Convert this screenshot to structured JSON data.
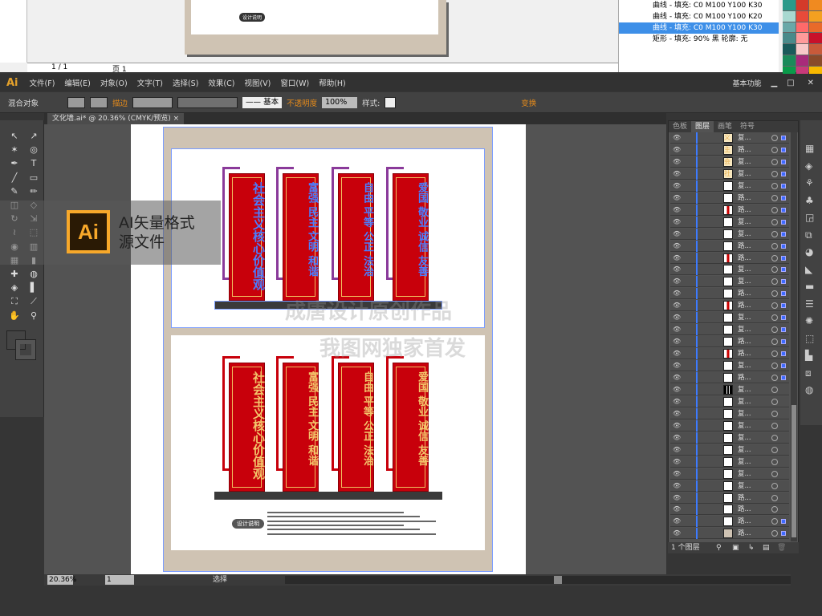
{
  "corel": {
    "page_nav": "1 / 1",
    "page_tab": "页 1",
    "design_note_label": "设计说明",
    "object_manager": [
      {
        "label": "曲线 - 填充: C0 M100 Y100 K30",
        "selected": false
      },
      {
        "label": "曲线 - 填充: C0 M100 Y100 K20",
        "selected": false
      },
      {
        "label": "曲线 - 填充: C0 M100 Y100 K30",
        "selected": true
      },
      {
        "label": "矩形 - 填充: 90% 黑 轮廓: 无",
        "selected": false
      }
    ],
    "palette": [
      "#2a9a8a",
      "#d43a2a",
      "#f08a20",
      "#a8d8d0",
      "#e84a3a",
      "#f4a020",
      "#6aa8a8",
      "#ff6a6a",
      "#e86a2a",
      "#4a8a8a",
      "#ff9a9a",
      "#c8102a",
      "#1a5a5a",
      "#f8c8c8",
      "#c85a3a",
      "#1a8a5a",
      "#a82a7a",
      "#8a4a2a",
      "#0a9a4a",
      "#c83a7a",
      "#f8b800"
    ]
  },
  "app": {
    "logo": "Ai",
    "workspace": "基本功能"
  },
  "menu": [
    "文件(F)",
    "编辑(E)",
    "对象(O)",
    "文字(T)",
    "选择(S)",
    "效果(C)",
    "视图(V)",
    "窗口(W)",
    "帮助(H)"
  ],
  "control": {
    "object_type": "混合对象",
    "stroke_label": "描边",
    "stroke_style": "基本",
    "opacity_label": "不透明度",
    "opacity_value": "100%",
    "style_label": "样式:",
    "transform_label": "变换"
  },
  "document": {
    "tab_title": "文化墙.ai* @ 20.36% (CMYK/预览)"
  },
  "overlay": {
    "line1": "AI矢量格式",
    "line2": "源文件"
  },
  "watermarks": [
    "成唐设计原创作品",
    "我图网独家首发"
  ],
  "artwork": {
    "panels": [
      "社会主义核心价值观",
      "富强 民主 文明 和谐",
      "自由 平等 公正 法治",
      "爱国 敬业 诚信 友善"
    ],
    "design_note": "设计说明"
  },
  "layers_panel": {
    "tabs": [
      "色板",
      "图层",
      "画笔",
      "符号"
    ],
    "active_tab": "图层",
    "footer": "1 个图层",
    "rows": [
      {
        "name": "复...",
        "thumb": "义",
        "target": true
      },
      {
        "name": "路...",
        "thumb": "主",
        "target": true
      },
      {
        "name": "复...",
        "thumb": "会",
        "target": true
      },
      {
        "name": "复...",
        "thumb": "社",
        "target": true
      },
      {
        "name": "复...",
        "thumb": "",
        "target": true
      },
      {
        "name": "路...",
        "thumb": "",
        "target": true
      },
      {
        "name": "路...",
        "thumb": "red",
        "target": true
      },
      {
        "name": "复...",
        "thumb": "",
        "target": true
      },
      {
        "name": "复...",
        "thumb": "",
        "target": true
      },
      {
        "name": "路...",
        "thumb": "",
        "target": true
      },
      {
        "name": "路...",
        "thumb": "red",
        "target": true
      },
      {
        "name": "复...",
        "thumb": "",
        "target": true
      },
      {
        "name": "复...",
        "thumb": "",
        "target": true
      },
      {
        "name": "路...",
        "thumb": "",
        "target": true
      },
      {
        "name": "路...",
        "thumb": "red",
        "target": true
      },
      {
        "name": "复...",
        "thumb": "",
        "target": true
      },
      {
        "name": "复...",
        "thumb": "",
        "target": true
      },
      {
        "name": "路...",
        "thumb": "",
        "target": true
      },
      {
        "name": "路...",
        "thumb": "red",
        "target": true
      },
      {
        "name": "复...",
        "thumb": "",
        "target": true
      },
      {
        "name": "路...",
        "thumb": "",
        "target": true
      },
      {
        "name": "复...",
        "thumb": "black",
        "target": false
      },
      {
        "name": "复...",
        "thumb": "",
        "target": false
      },
      {
        "name": "复...",
        "thumb": "",
        "target": false
      },
      {
        "name": "复...",
        "thumb": "",
        "target": false
      },
      {
        "name": "复...",
        "thumb": "",
        "target": false
      },
      {
        "name": "复...",
        "thumb": "",
        "target": false
      },
      {
        "name": "复...",
        "thumb": "",
        "target": false
      },
      {
        "name": "复...",
        "thumb": "",
        "target": false
      },
      {
        "name": "复...",
        "thumb": "",
        "target": false
      },
      {
        "name": "路...",
        "thumb": "",
        "target": false
      },
      {
        "name": "路...",
        "thumb": "",
        "target": false
      },
      {
        "name": "路...",
        "thumb": "",
        "target": true
      },
      {
        "name": "路...",
        "thumb": "beige",
        "target": true
      }
    ]
  },
  "status": {
    "zoom": "20.36%",
    "artboard": "1",
    "tool": "选择"
  }
}
